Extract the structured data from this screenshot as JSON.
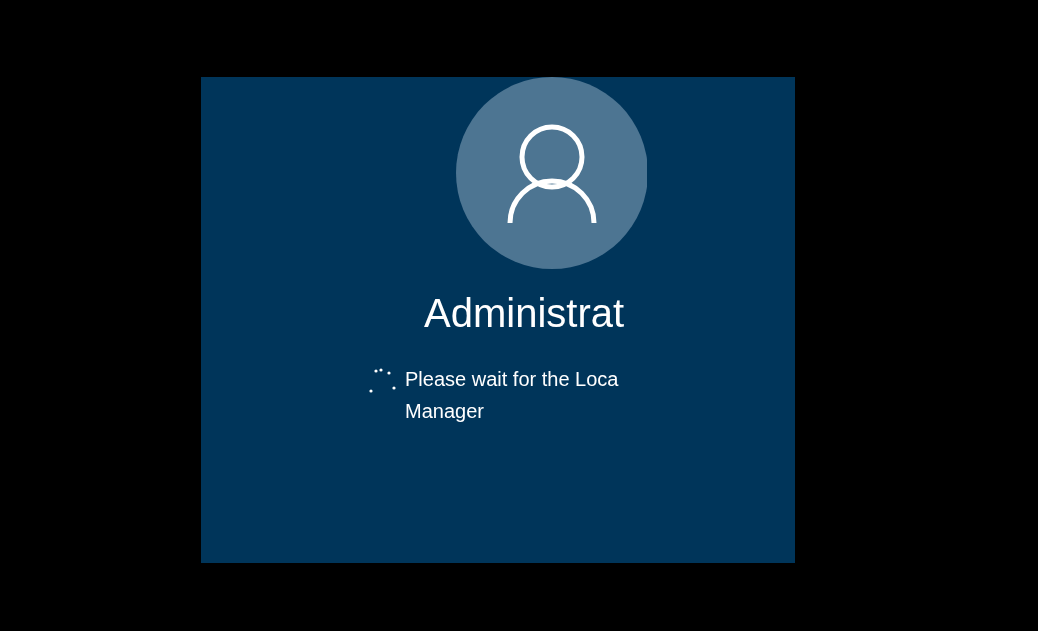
{
  "user": {
    "name": "Administrat"
  },
  "status": {
    "lines": [
      "Please wait for the Loca",
      "Manager"
    ]
  }
}
